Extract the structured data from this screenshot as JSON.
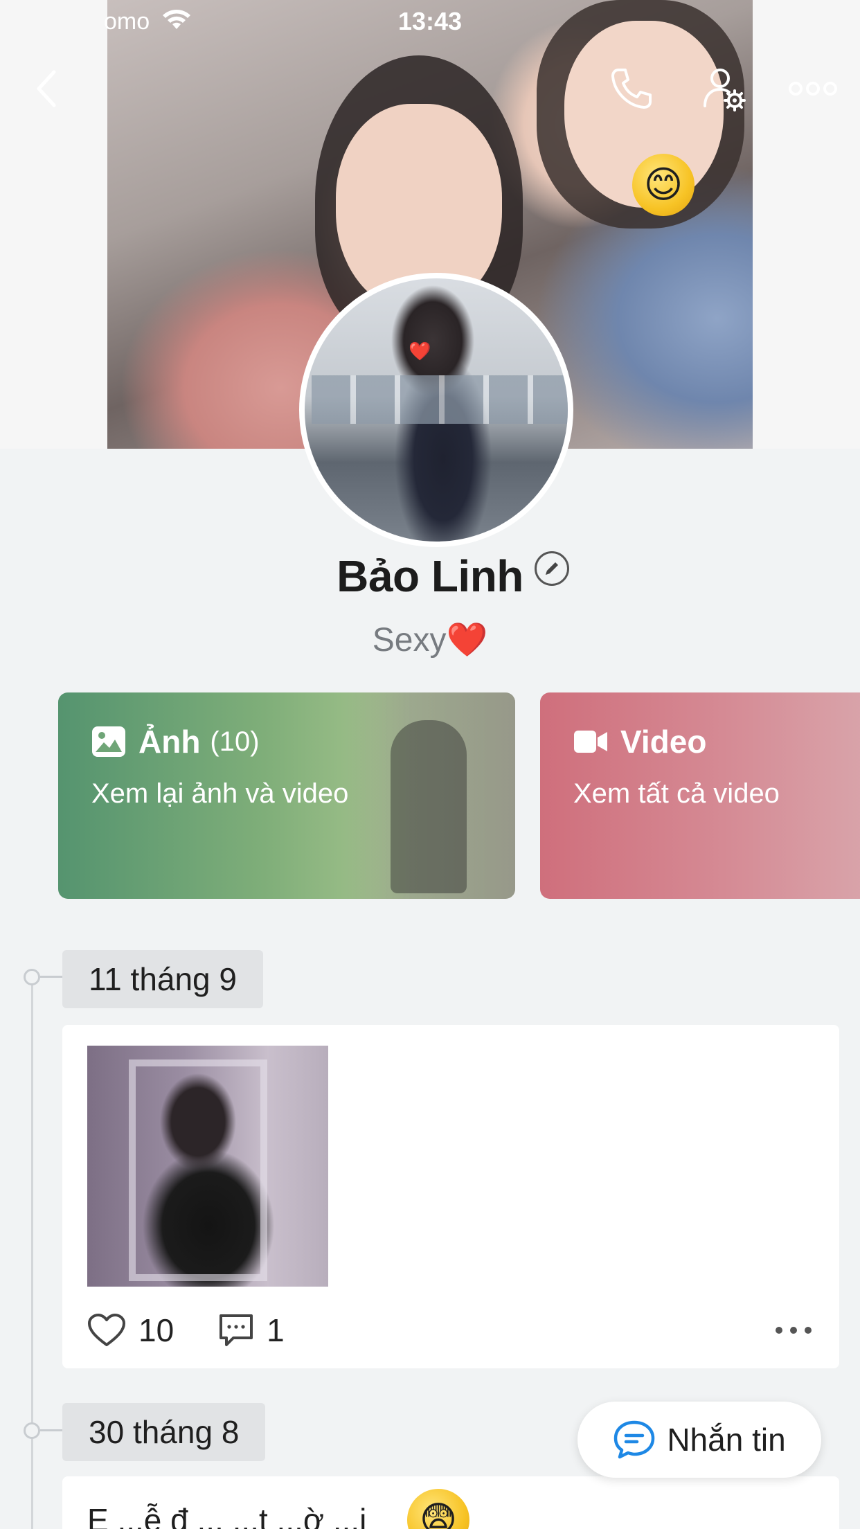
{
  "status_bar": {
    "carrier": "omo",
    "time": "13:43"
  },
  "cover": {
    "sticker_emoji": "😊"
  },
  "avatar": {
    "sticker_emoji": "❤️"
  },
  "profile": {
    "name": "Bảo Linh",
    "bio": "Sexy❤️"
  },
  "media_cards": {
    "photos": {
      "title": "Ảnh",
      "count": "(10)",
      "subtitle": "Xem lại ảnh và video",
      "icon": "image-icon"
    },
    "videos": {
      "title": "Video",
      "subtitle": "Xem tất cả video",
      "icon": "video-camera-icon"
    }
  },
  "timeline": [
    {
      "date": "11 tháng 9",
      "likes": "10",
      "comments": "1"
    },
    {
      "date": "30 tháng 8",
      "text_preview": "E ...ễ  đ ...  ...t ...ờ ...ị",
      "emoji": "😨"
    }
  ],
  "message_button": {
    "label": "Nhắn tin"
  },
  "colors": {
    "photos_card": "#6fa577",
    "video_card": "#d47e89",
    "background": "#f1f3f4",
    "accent_blue": "#1e88e5"
  }
}
